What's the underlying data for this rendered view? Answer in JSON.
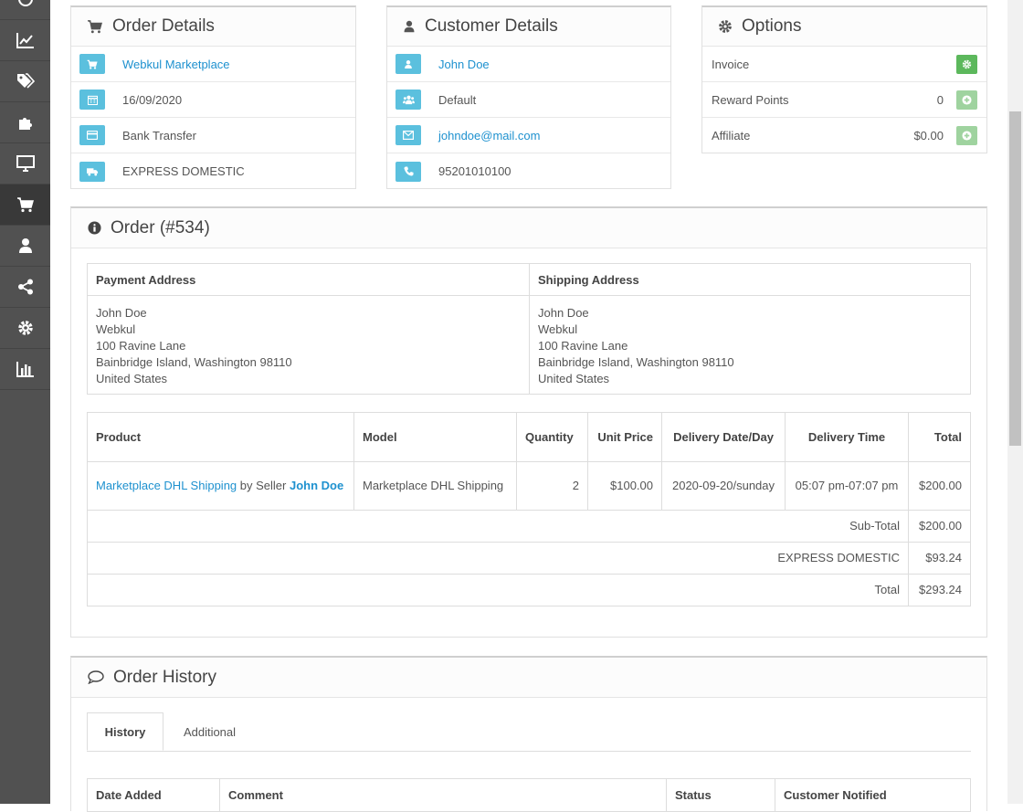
{
  "sidebar": {
    "items": [
      {
        "icon": "dashboard-icon"
      },
      {
        "icon": "chart-line-icon"
      },
      {
        "icon": "tags-icon"
      },
      {
        "icon": "puzzle-icon"
      },
      {
        "icon": "desktop-icon"
      },
      {
        "icon": "shopping-cart-icon",
        "active": true
      },
      {
        "icon": "user-icon"
      },
      {
        "icon": "share-icon"
      },
      {
        "icon": "cog-icon"
      },
      {
        "icon": "bar-chart-icon"
      }
    ]
  },
  "order_details": {
    "title": "Order Details",
    "store": "Webkul Marketplace",
    "date": "16/09/2020",
    "payment": "Bank Transfer",
    "shipping": "EXPRESS DOMESTIC"
  },
  "customer_details": {
    "title": "Customer Details",
    "name": "John Doe",
    "group": "Default",
    "email": "johndoe@mail.com",
    "phone": "95201010100"
  },
  "options": {
    "title": "Options",
    "invoice_label": "Invoice",
    "reward_label": "Reward Points",
    "reward_value": "0",
    "affiliate_label": "Affiliate",
    "affiliate_value": "$0.00"
  },
  "order": {
    "title": "Order (#534)",
    "payment_address_header": "Payment Address",
    "shipping_address_header": "Shipping Address",
    "payment_address": [
      "John Doe",
      "Webkul",
      "100 Ravine Lane",
      "Bainbridge Island, Washington 98110",
      "United States"
    ],
    "shipping_address": [
      "John Doe",
      "Webkul",
      "100 Ravine Lane",
      "Bainbridge Island, Washington 98110",
      "United States"
    ],
    "columns": {
      "product": "Product",
      "model": "Model",
      "quantity": "Quantity",
      "unit_price": "Unit Price",
      "delivery_date": "Delivery Date/Day",
      "delivery_time": "Delivery Time",
      "total": "Total"
    },
    "item": {
      "product": "Marketplace DHL Shipping",
      "by_seller": "by Seller",
      "seller": "John Doe",
      "model": "Marketplace DHL Shipping",
      "quantity": "2",
      "unit_price": "$100.00",
      "delivery_date": "2020-09-20/sunday",
      "delivery_time": "05:07 pm-07:07 pm",
      "total": "$200.00"
    },
    "totals": [
      {
        "label": "Sub-Total",
        "value": "$200.00"
      },
      {
        "label": "EXPRESS DOMESTIC",
        "value": "$93.24"
      },
      {
        "label": "Total",
        "value": "$293.24"
      }
    ]
  },
  "history": {
    "title": "Order History",
    "tabs": [
      "History",
      "Additional"
    ],
    "columns": [
      "Date Added",
      "Comment",
      "Status",
      "Customer Notified"
    ]
  },
  "colors": {
    "sidebar": "#515151",
    "info_button": "#5bc0de",
    "success_button": "#5cb85c",
    "link": "#1e91cf"
  }
}
